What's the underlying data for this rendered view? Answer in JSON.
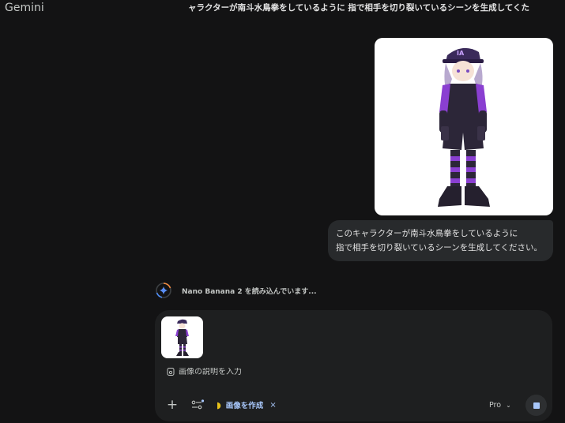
{
  "app": {
    "brand": "Gemini"
  },
  "header": {
    "chat_title": "ャラクターが南斗水鳥拳をしているように 指で相手を切り裂いているシーンを生成してくた"
  },
  "user_message": {
    "line1": "このキャラクターが南斗水鳥拳をしているように",
    "line2": "指で相手を切り裂いているシーンを生成してください。"
  },
  "status": {
    "text": "Nano Banana 2 を読み込んでいます..."
  },
  "composer": {
    "placeholder": "画像の説明を入力",
    "value": "",
    "plus_label": "+",
    "tool_chip": {
      "icon": "banana-icon",
      "label": "画像を作成",
      "close": "×"
    },
    "model_label": "Pro",
    "model_chevron": "⌄"
  },
  "colors": {
    "background": "#131314",
    "surface": "#1e1f20",
    "bubble": "#282a2c",
    "accent": "#a8c7fa",
    "character_purple": "#8a3fd1"
  }
}
